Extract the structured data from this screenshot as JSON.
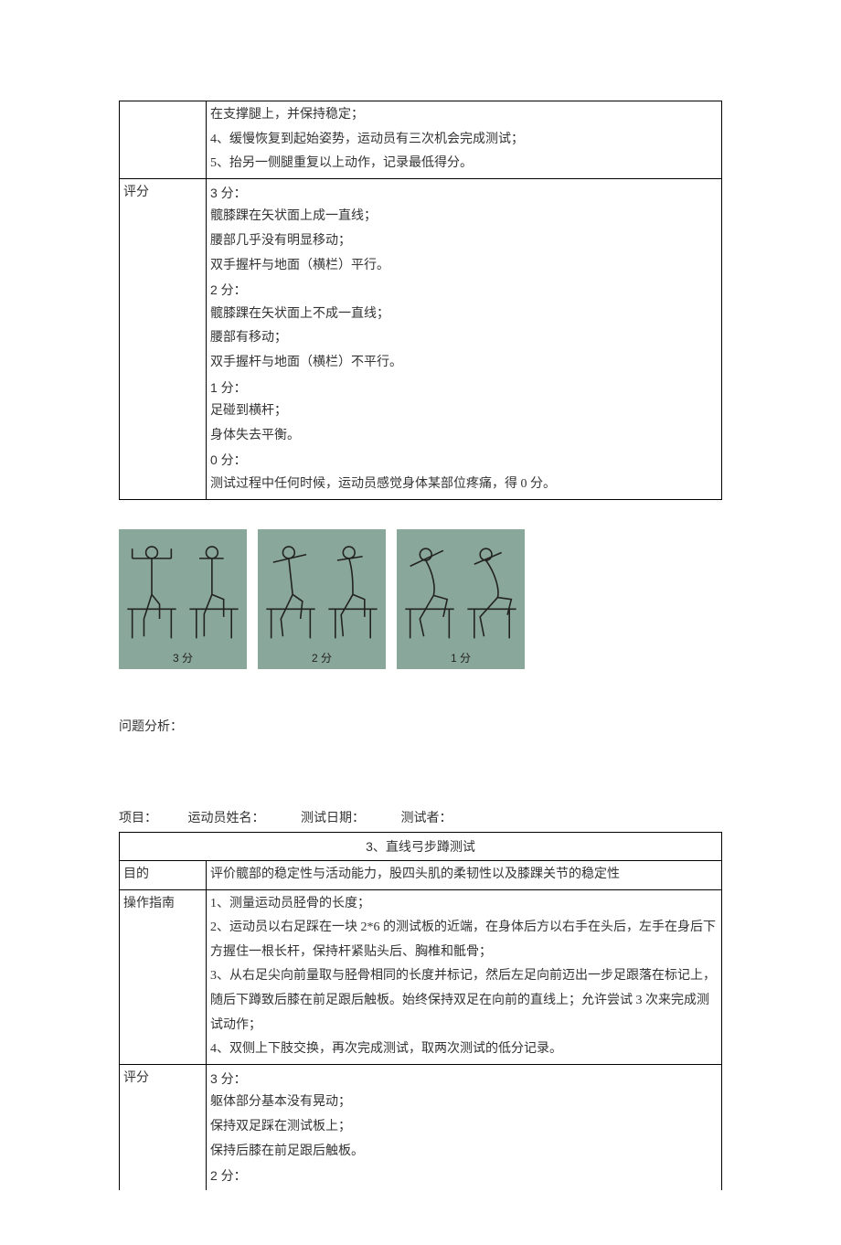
{
  "table1": {
    "op_extra": [
      "在支撑腿上，并保持稳定；",
      "4、缓慢恢复到起始姿势，运动员有三次机会完成测试；",
      "5、抬另一侧腿重复以上动作，记录最低得分。"
    ],
    "score_label": "评分",
    "score3_head": "3 分：",
    "score3": [
      "髋膝踝在矢状面上成一直线；",
      "腰部几乎没有明显移动；",
      "双手握杆与地面（横栏）平行。"
    ],
    "score2_head": "2 分：",
    "score2": [
      "髋膝踝在矢状面上不成一直线；",
      "腰部有移动；",
      "双手握杆与地面（横栏）不平行。"
    ],
    "score1_head": "1 分：",
    "score1": [
      "足碰到横杆；",
      "身体失去平衡。"
    ],
    "score0_head": "0 分：",
    "score0": [
      "测试过程中任何时候，运动员感觉身体某部位疼痛，得 0 分。"
    ]
  },
  "figures": {
    "cap1": "3 分",
    "cap2": "2 分",
    "cap3": "1 分"
  },
  "analysis_label": "问题分析：",
  "form_header": {
    "proj": "项目：",
    "name": "运动员姓名：",
    "date": "测试日期：",
    "tester": "测试者："
  },
  "table2": {
    "title": "3、直线弓步蹲测试",
    "purpose_label": "目的",
    "purpose_text": "评价髋部的稳定性与活动能力，股四头肌的柔韧性以及膝踝关节的稳定性",
    "guide_label": "操作指南",
    "guide_lines": [
      "1、测量运动员胫骨的长度；",
      "2、运动员以右足踩在一块 2*6 的测试板的近端，在身体后方以右手在头后，左手在身后下方握住一根长杆，保持杆紧贴头后、胸椎和骶骨；",
      "3、从右足尖向前量取与胫骨相同的长度并标记，然后左足向前迈出一步足跟落在标记上，随后下蹲致后膝在前足跟后触板。始终保持双足在向前的直线上；允许尝试 3 次来完成测试动作；",
      "4、双侧上下肢交换，再次完成测试，取两次测试的低分记录。"
    ],
    "score_label": "评分",
    "score3_head": "3 分：",
    "score3": [
      "躯体部分基本没有晃动；",
      "保持双足踩在测试板上；",
      "保持后膝在前足跟后触板。"
    ],
    "score2_head": "2 分："
  }
}
